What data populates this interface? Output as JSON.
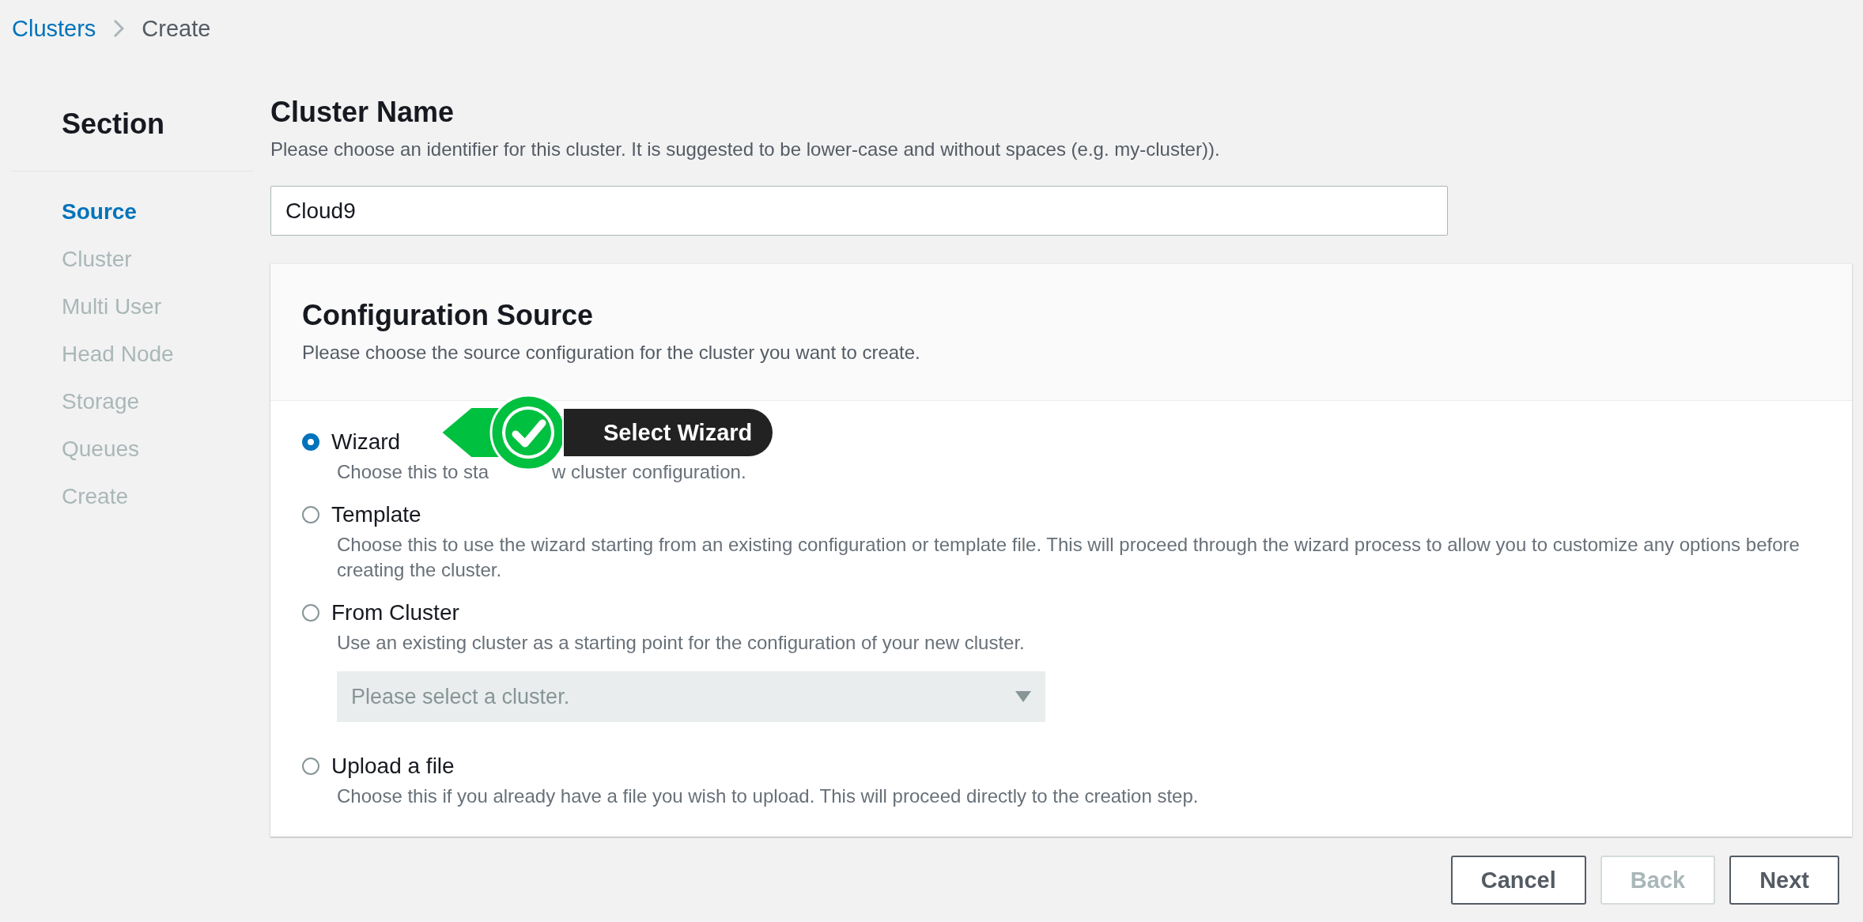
{
  "breadcrumb": [
    {
      "label": "Clusters",
      "link": true
    },
    {
      "label": "Create",
      "link": false
    }
  ],
  "sidebar": {
    "title": "Section",
    "items": [
      {
        "label": "Source",
        "selected": true
      },
      {
        "label": "Cluster",
        "selected": false
      },
      {
        "label": "Multi User",
        "selected": false
      },
      {
        "label": "Head Node",
        "selected": false
      },
      {
        "label": "Storage",
        "selected": false
      },
      {
        "label": "Queues",
        "selected": false
      },
      {
        "label": "Create",
        "selected": false
      }
    ]
  },
  "cluster_name": {
    "title": "Cluster Name",
    "description": "Please choose an identifier for this cluster. It is suggested to be lower-case and without spaces (e.g. my-cluster)).",
    "value": "Cloud9"
  },
  "configuration_source": {
    "title": "Configuration Source",
    "description": "Please choose the source configuration for the cluster you want to create.",
    "options": [
      {
        "label": "Wizard",
        "selected": true,
        "description_parts": [
          "Choose this to sta",
          "w cluster configuration."
        ],
        "callout": "Select Wizard"
      },
      {
        "label": "Template",
        "selected": false,
        "description": "Choose this to use the wizard starting from an existing configuration or template file. This will proceed through the wizard process to allow you to customize any options before creating the cluster."
      },
      {
        "label": "From Cluster",
        "selected": false,
        "description": "Use an existing cluster as a starting point for the configuration of your new cluster.",
        "select": {
          "placeholder": "Please select a cluster.",
          "disabled": true
        }
      },
      {
        "label": "Upload a file",
        "selected": false,
        "description": "Choose this if you already have a file you wish to upload. This will proceed directly to the creation step."
      }
    ]
  },
  "buttons": [
    {
      "label": "Cancel",
      "disabled": false
    },
    {
      "label": "Back",
      "disabled": true
    },
    {
      "label": "Next",
      "disabled": false
    }
  ]
}
